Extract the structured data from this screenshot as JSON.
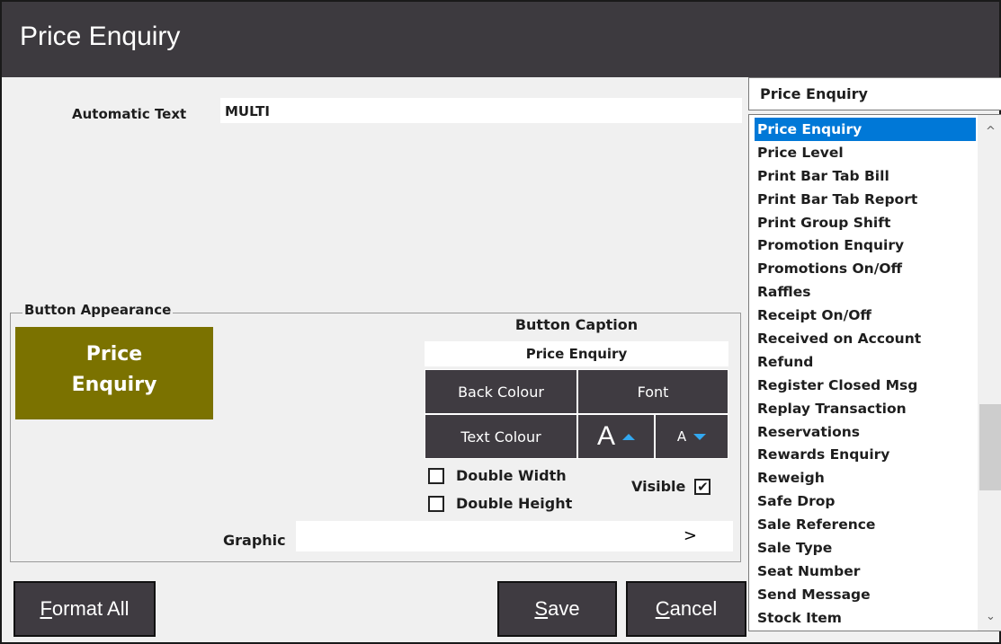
{
  "window": {
    "title": "Price Enquiry"
  },
  "form": {
    "automatic_text_label": "Automatic Text",
    "automatic_text_value": "MULTI",
    "graphic_label": "Graphic",
    "graphic_button": ">"
  },
  "appearance": {
    "group_label": "Button Appearance",
    "preview_line1": "Price",
    "preview_line2": "Enquiry",
    "preview_color": "#7b7200",
    "caption_title": "Button Caption",
    "caption_value": "Price Enquiry",
    "back_colour_label": "Back Colour",
    "font_label": "Font",
    "text_colour_label": "Text Colour",
    "font_large_glyph": "A",
    "font_small_glyph": "A",
    "double_width_label": "Double Width",
    "double_height_label": "Double Height",
    "visible_label": "Visible",
    "visible_checked": "✔"
  },
  "buttons": {
    "format_all_prefix": "F",
    "format_all_rest": "ormat All",
    "save_prefix": "S",
    "save_rest": "ave",
    "cancel_prefix": "C",
    "cancel_rest": "ancel"
  },
  "function_list": {
    "selected_value": "Price Enquiry",
    "items": [
      "Price Enquiry",
      "Price Level",
      "Print Bar Tab Bill",
      "Print Bar Tab Report",
      "Print Group Shift",
      "Promotion Enquiry",
      "Promotions On/Off",
      "Raffles",
      "Receipt On/Off",
      "Received on Account",
      "Refund",
      "Register Closed Msg",
      "Replay Transaction",
      "Reservations",
      "Rewards Enquiry",
      "Reweigh",
      "Safe Drop",
      "Sale Reference",
      "Sale Type",
      "Seat Number",
      "Send Message",
      "Stock Item"
    ],
    "scroll_up": "^",
    "scroll_down": "⌄"
  },
  "colors": {
    "accent": "#0078d7",
    "button_dark": "#3f3b41",
    "title_bar": "#3d3a3f"
  }
}
